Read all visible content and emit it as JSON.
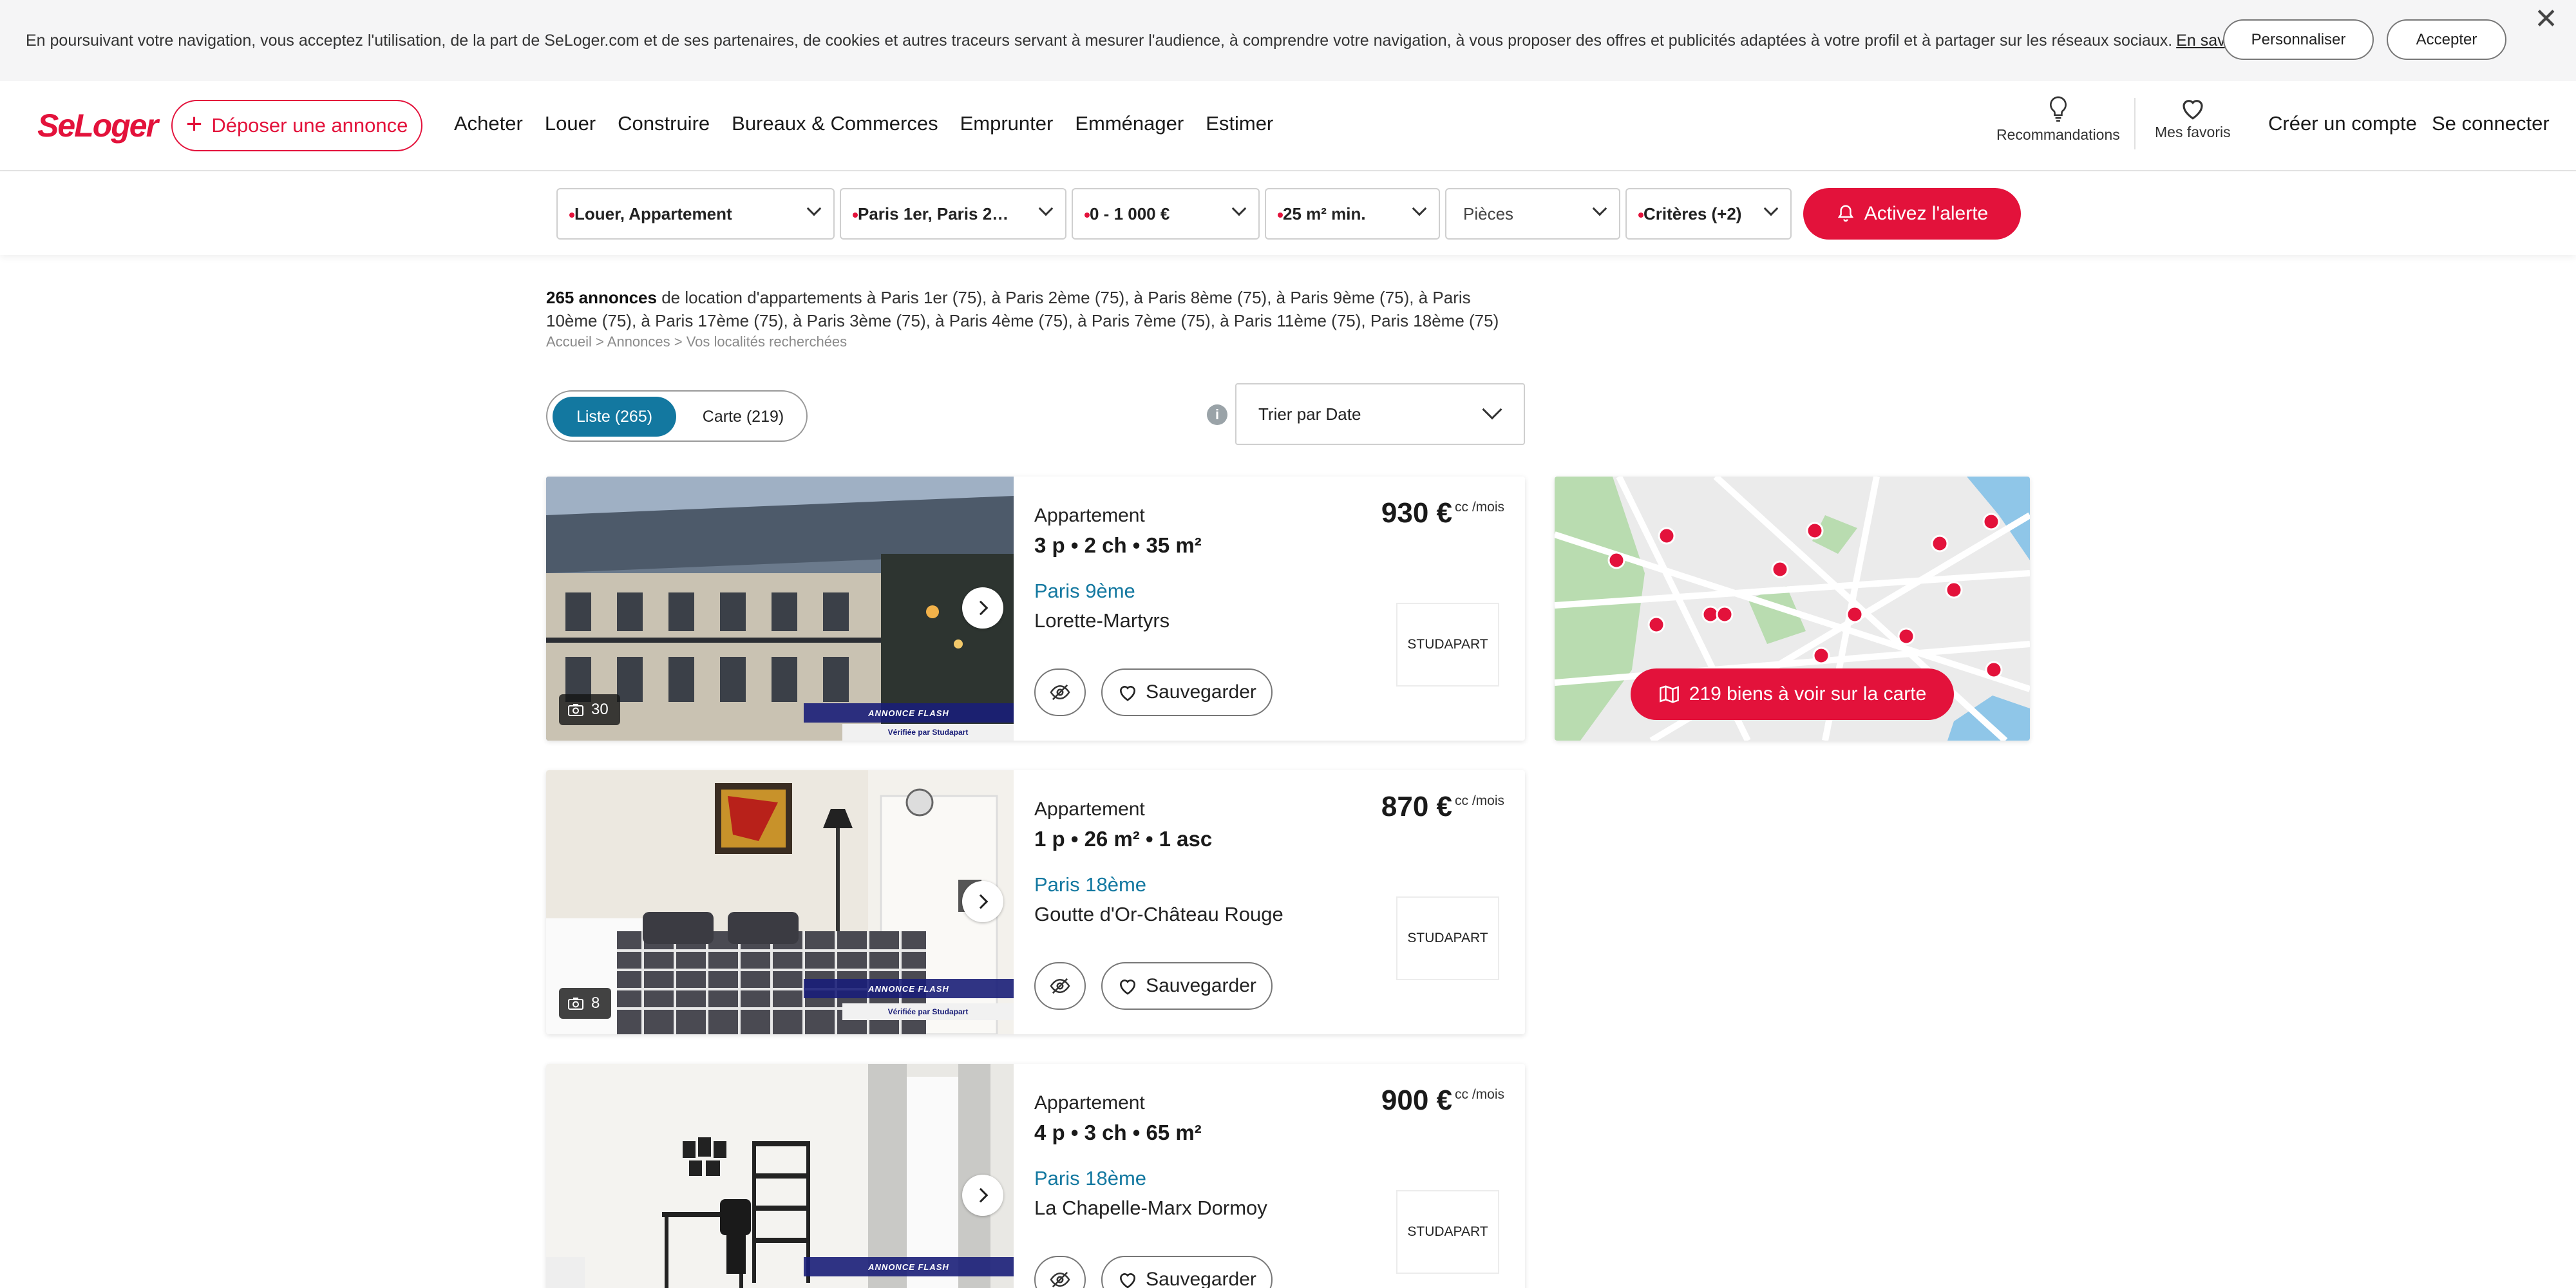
{
  "cookie": {
    "text": "En poursuivant votre navigation, vous acceptez l'utilisation, de la part de SeLoger.com et de ses partenaires, de cookies et autres traceurs servant à mesurer l'audience, à comprendre votre navigation, à vous proposer des offres et publicités adaptées à votre profil et à partager sur les réseaux sociaux.",
    "link": "En savoir plus.",
    "personalize": "Personnaliser",
    "accept": "Accepter",
    "close": "✕"
  },
  "header": {
    "logo": "SeLoger",
    "post_ad": "Déposer une annonce",
    "menu": [
      "Acheter",
      "Louer",
      "Construire",
      "Bureaux & Commerces",
      "Emprunter",
      "Emménager",
      "Estimer"
    ],
    "recommendations": "Recommandations",
    "favorites": "Mes favoris",
    "create_account": "Créer un compte",
    "login": "Se connecter"
  },
  "filters": {
    "transaction": "Louer, Appartement",
    "location": "Paris 1er, Paris 2…",
    "budget": "0 - 1 000 €",
    "surface": "25 m² min.",
    "rooms": "Pièces",
    "criteria": "Critères (+2)",
    "alert": "Activez l'alerte"
  },
  "results": {
    "count": "265 annonces",
    "text": "de location d'appartements à Paris 1er (75), à Paris 2ème (75), à Paris 8ème (75), à Paris 9ème (75), à Paris 10ème (75), à Paris 17ème (75), à Paris 3ème (75), à Paris 4ème (75), à Paris 7ème (75), à Paris 11ème (75), Paris 18ème (75)",
    "breadcrumb": "Accueil > Annonces > Vos localités recherchées",
    "list_tab": "Liste (265)",
    "map_tab": "Carte  (219)",
    "sort": "Trier par Date"
  },
  "listings": [
    {
      "type": "Appartement",
      "details": "3 p • 2 ch • 35 m²",
      "city": "Paris 9ème",
      "district": "Lorette-Martyrs",
      "price": "930 €",
      "price_suffix": "cc /mois",
      "photos": "30",
      "save": "Sauvegarder",
      "agency": "STUDAPART",
      "flash": "ANNONCE FLASH",
      "verified": "Vérifiée par Studapart"
    },
    {
      "type": "Appartement",
      "details": "1 p • 26 m² • 1 asc",
      "city": "Paris 18ème",
      "district": "Goutte d'Or-Château Rouge",
      "price": "870 €",
      "price_suffix": "cc /mois",
      "photos": "8",
      "save": "Sauvegarder",
      "agency": "STUDAPART",
      "flash": "ANNONCE FLASH",
      "verified": "Vérifiée par Studapart"
    },
    {
      "type": "Appartement",
      "details": "4 p • 3 ch • 65 m²",
      "city": "Paris 18ème",
      "district": "La Chapelle-Marx Dormoy",
      "price": "900 €",
      "price_suffix": "cc /mois",
      "photos": "",
      "save": "Sauvegarder",
      "agency": "STUDAPART",
      "flash": "ANNONCE FLASH",
      "verified": ""
    }
  ],
  "map": {
    "button": "219 biens à voir sur la carte"
  },
  "colors": {
    "brand": "#e3123b",
    "link": "#1378a0"
  }
}
